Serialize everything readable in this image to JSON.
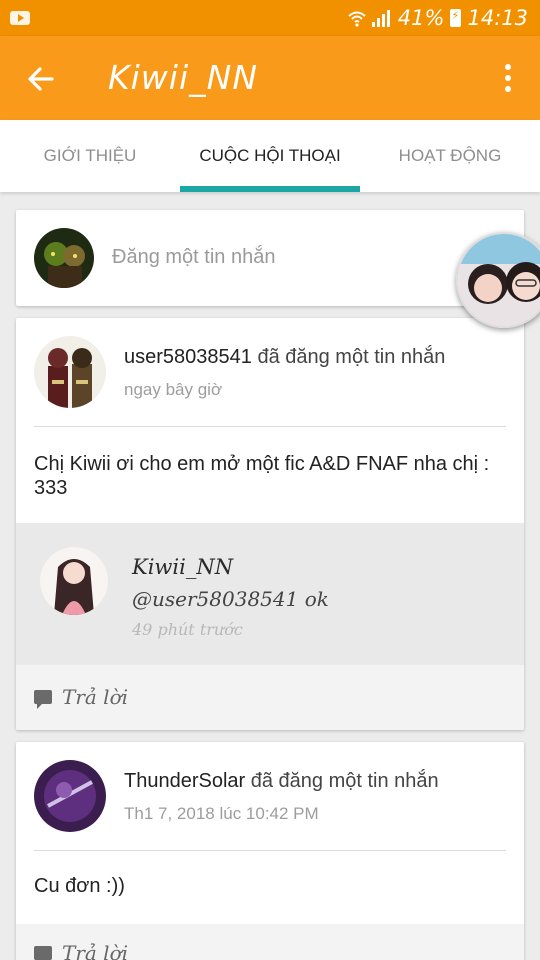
{
  "status_bar": {
    "battery_percent": "41%",
    "time": "14:13",
    "icons": [
      "youtube-icon",
      "wifi-icon",
      "signal-icon",
      "battery-icon"
    ]
  },
  "app_bar": {
    "title": "Kiwii_NN",
    "back_icon": "back-arrow-icon",
    "menu_icon": "more-vert-icon",
    "color": "#f99a1b"
  },
  "tabs": [
    {
      "label": "GIỚI THIỆU",
      "active": false
    },
    {
      "label": "CUỘC HỘI THOẠI",
      "active": true
    },
    {
      "label": "HOẠT ĐỘNG",
      "active": false
    }
  ],
  "accent_color": "#1ba8a5",
  "compose": {
    "placeholder": "Đăng một tin nhắn"
  },
  "posts": [
    {
      "author": "user58038541",
      "action": "đã đăng một tin nhắn",
      "time": "ngay bây giờ",
      "body": "Chị Kiwii ơi cho em mở một fic A&D FNAF nha chị : 333",
      "reply": {
        "author": "Kiwii_NN",
        "text": "@user58038541  ok",
        "time": "49 phút trước"
      },
      "reply_label": "Trả lời"
    },
    {
      "author": "ThunderSolar",
      "action": "đã đăng một tin nhắn",
      "time": "Th1 7, 2018 lúc 10:42 PM",
      "body": "Cu đơn :))",
      "reply_label": "Trả lời"
    }
  ]
}
